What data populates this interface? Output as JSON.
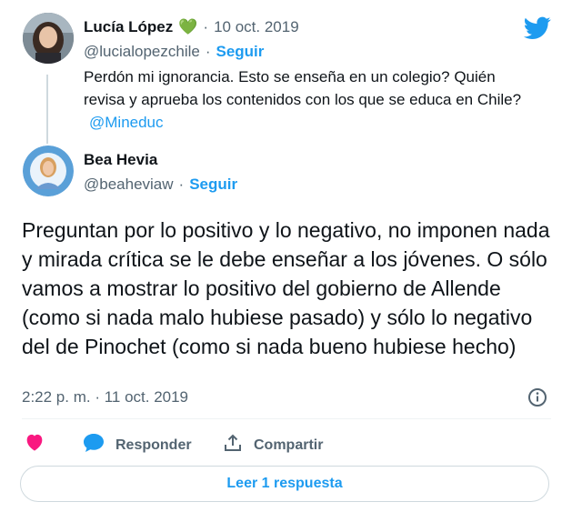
{
  "quoted_tweet": {
    "author_name": "Lucía López",
    "author_emoji": "💚",
    "separator": "·",
    "date": "10 oct. 2019",
    "handle": "@lucialopezchile",
    "follow_label": "Seguir",
    "text": "Perdón mi ignorancia. Esto se enseña en un colegio? Quién revisa y aprueba los contenidos con los que se educa en Chile?",
    "mention": "@Mineduc"
  },
  "main_tweet": {
    "author_name": "Bea Hevia",
    "handle": "@beaheviaw",
    "separator": "·",
    "follow_label": "Seguir",
    "text": "Preguntan por lo positivo y lo negativo, no imponen nada y mirada crítica se le debe enseñar a los jóvenes. O sólo vamos a mostrar lo positivo del gobierno de Allende (como si nada malo hubiese pasado) y sólo lo negativo del de Pinochet (como si nada bueno hubiese hecho)",
    "timestamp": "2:22 p. m. · 11 oct. 2019"
  },
  "actions": {
    "reply_label": "Responder",
    "share_label": "Compartir",
    "read_replies_label": "Leer 1 respuesta"
  },
  "colors": {
    "brand": "#1d9bf0",
    "like": "#f91880",
    "muted": "#536471"
  },
  "icons": [
    "twitter-bird-icon",
    "info-icon",
    "heart-icon",
    "speech-bubble-icon",
    "share-icon"
  ]
}
